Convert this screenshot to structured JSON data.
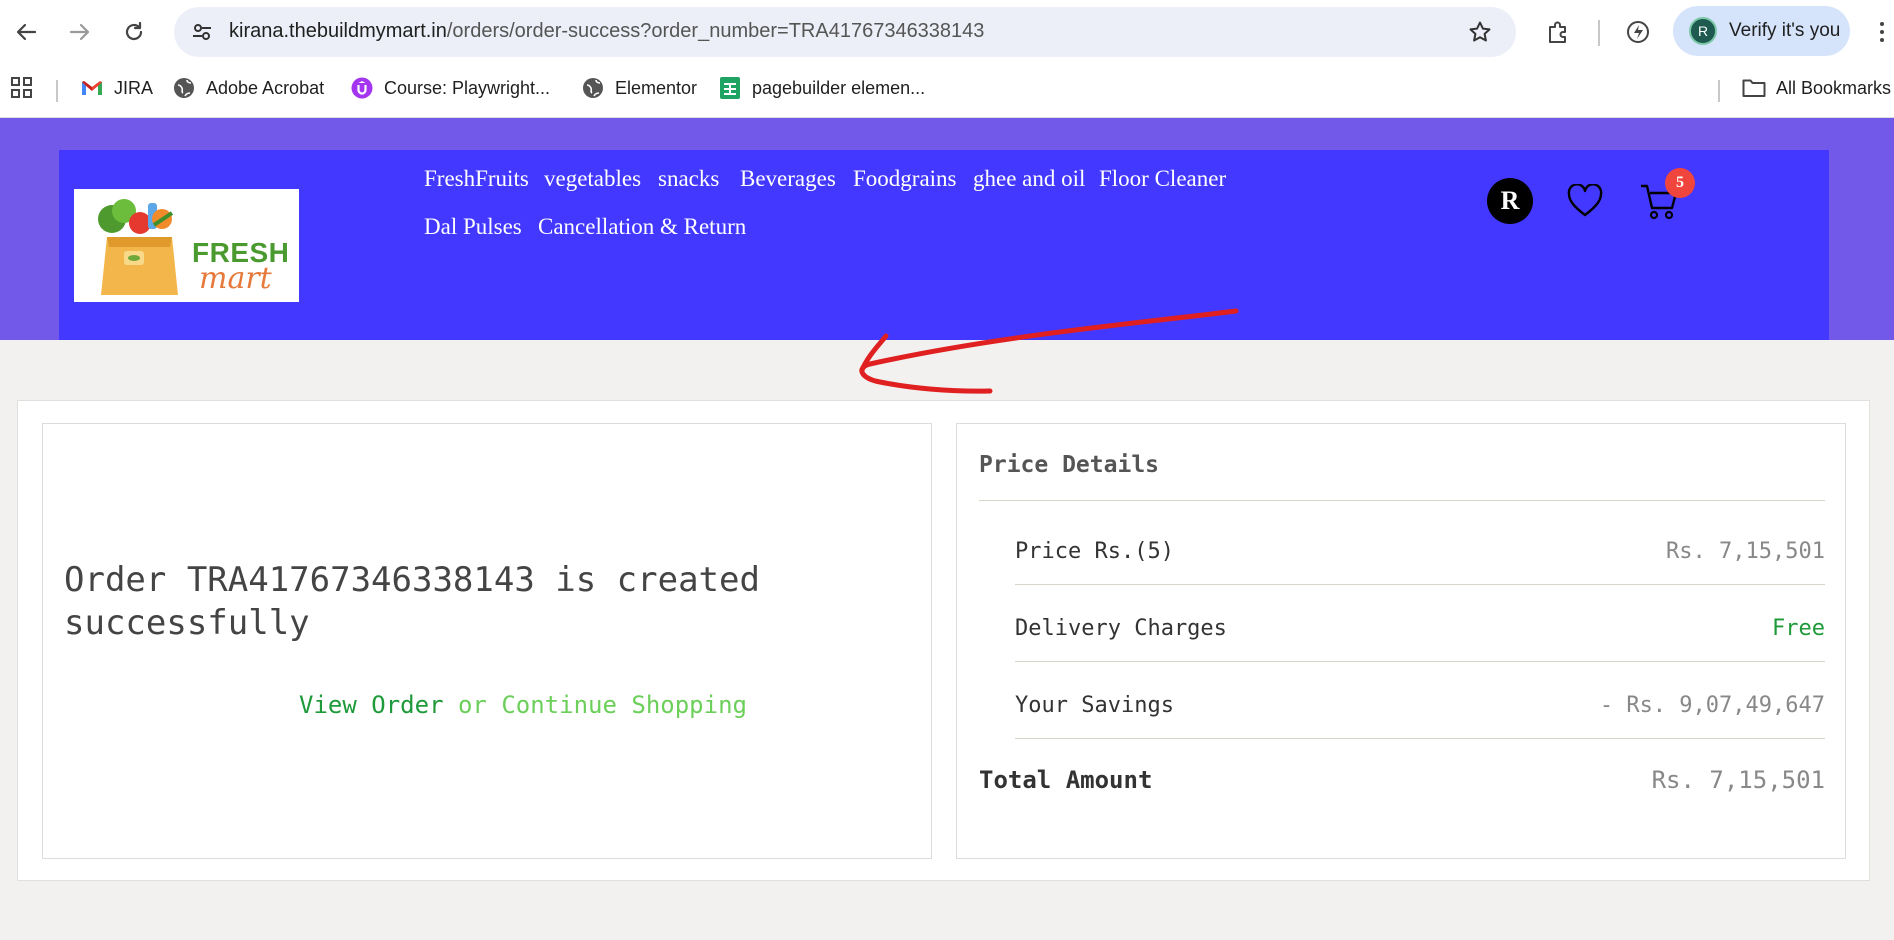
{
  "browser": {
    "url_host": "kirana.thebuildmymart.in",
    "url_path": "/orders/order-success?order_number=TRA41767346338143",
    "verify_avatar": "R",
    "verify_label": "Verify it's you",
    "bookmarks": [
      {
        "label": "JIRA",
        "icon": "gmail-icon"
      },
      {
        "label": "Adobe Acrobat",
        "icon": "globe-icon"
      },
      {
        "label": "Course: Playwright...",
        "icon": "udemy-icon"
      },
      {
        "label": "Elementor",
        "icon": "globe-icon"
      },
      {
        "label": "pagebuilder elemen...",
        "icon": "sheets-icon"
      }
    ],
    "all_bookmarks": "All Bookmarks"
  },
  "site": {
    "logo_line1": "FRESH",
    "logo_line2": "mart",
    "menu": [
      "FreshFruits",
      "vegetables",
      "snacks",
      "Beverages",
      "Foodgrains",
      "ghee and oil",
      "Floor Cleaner",
      "Dal Pulses",
      "Cancellation & Return"
    ],
    "avatar_initial": "R",
    "cart_count": "5",
    "colors": {
      "header_outer": "#7259ea",
      "header_inner": "#4338ff",
      "badge": "#f0453c",
      "link_green": "#1f9a3a",
      "link_light_green": "#6ccf5a",
      "annotation_arrow": "#e02020"
    }
  },
  "order": {
    "message": "Order TRA41767346338143 is created successfully",
    "view_order": "View Order",
    "continue_shopping": "or Continue Shopping"
  },
  "price": {
    "title": "Price Details",
    "rows": [
      {
        "label": "Price Rs.(5)",
        "value": "Rs. 7,15,501"
      },
      {
        "label": "Delivery Charges",
        "value": "Free"
      },
      {
        "label": "Your Savings",
        "value": "- Rs. 9,07,49,647"
      }
    ],
    "total_label": "Total Amount",
    "total_value": "Rs. 7,15,501"
  }
}
